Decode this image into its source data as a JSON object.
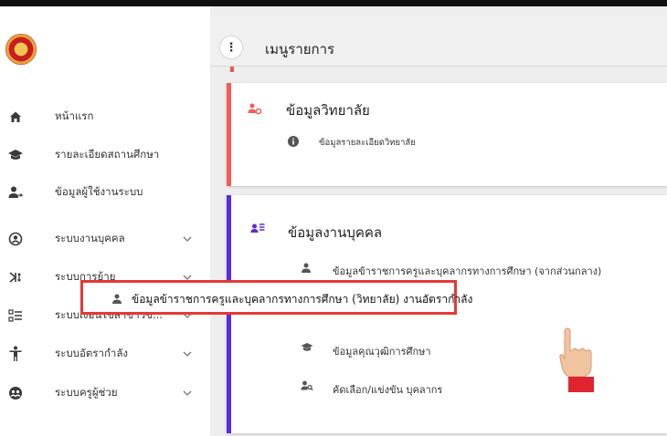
{
  "header": {
    "title": "เมนูรายการ",
    "menu_icon": "more-vert-icon"
  },
  "sidebar": {
    "items": [
      {
        "label": "หน้าแรก",
        "icon": "home-icon",
        "has_chevron": false
      },
      {
        "label": "รายละเอียดสถานศึกษา",
        "icon": "school-icon",
        "has_chevron": false
      },
      {
        "label": "ข้อมูลผู้ใช้งานระบบ",
        "icon": "user-arrow-icon",
        "has_chevron": false
      },
      {
        "label": "ระบบงานบุคคล",
        "icon": "account-circle-icon",
        "has_chevron": true
      },
      {
        "label": "ระบบการย้าย",
        "icon": "transfer-icon",
        "has_chevron": true
      },
      {
        "label": "ระบบเงื่อนไขสาขาวิช...",
        "icon": "list-icon",
        "has_chevron": true
      },
      {
        "label": "ระบบอัตรากำลัง",
        "icon": "person-standing-icon",
        "has_chevron": true
      },
      {
        "label": "ระบบครูผู้ช่วย",
        "icon": "group-circle-icon",
        "has_chevron": true
      }
    ]
  },
  "cards": [
    {
      "title": "ข้อมูลวิทยาลัย",
      "accent": "#f55b5b",
      "icon": "user-settings-icon",
      "rows": [
        {
          "label": "ข้อมูลรายละเอียดวิทยาลัย",
          "icon": "info-icon"
        }
      ]
    },
    {
      "title": "ข้อมูลงานบุคคล",
      "accent": "#5b2bdd",
      "icon": "user-list-icon",
      "rows": [
        {
          "label": "ข้อมูลข้าราชการครูและบุคลากรทางการศึกษา (จากส่วนกลาง)",
          "icon": "person-icon"
        },
        {
          "label": "ข้อมูลข้าราชการครูและบุคลากรทางการศึกษา (วิทยาลัย) งานอัตรากำลัง",
          "icon": "person-icon",
          "highlighted": true
        },
        {
          "label": "ข้อมูลคุณวุฒิการศึกษา",
          "icon": "school-icon"
        },
        {
          "label": "คัดเลือก/แข่งขัน บุคลากร",
          "icon": "user-search-icon"
        }
      ]
    }
  ],
  "colors": {
    "highlight_border": "#e53935",
    "pointer_cuff": "#e0242f"
  }
}
